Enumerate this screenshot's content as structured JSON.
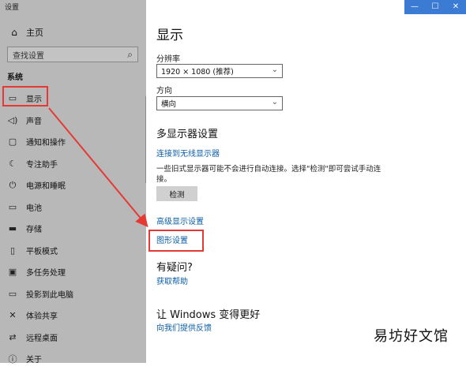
{
  "sidebar": {
    "app_title": "设置",
    "home": {
      "label": "主页",
      "icon": "home-icon"
    },
    "search_placeholder": "查找设置",
    "section_label": "系统",
    "items": [
      {
        "label": "显示",
        "icon": "monitor-icon"
      },
      {
        "label": "声音",
        "icon": "speaker-icon"
      },
      {
        "label": "通知和操作",
        "icon": "notification-icon"
      },
      {
        "label": "专注助手",
        "icon": "moon-icon"
      },
      {
        "label": "电源和睡眠",
        "icon": "power-icon"
      },
      {
        "label": "电池",
        "icon": "battery-icon"
      },
      {
        "label": "存储",
        "icon": "storage-icon"
      },
      {
        "label": "平板模式",
        "icon": "tablet-icon"
      },
      {
        "label": "多任务处理",
        "icon": "multitask-icon"
      },
      {
        "label": "投影到此电脑",
        "icon": "project-icon"
      },
      {
        "label": "体验共享",
        "icon": "share-icon"
      },
      {
        "label": "远程桌面",
        "icon": "remote-desktop-icon"
      },
      {
        "label": "关于",
        "icon": "info-icon"
      }
    ]
  },
  "window_controls": {
    "minimize": "—",
    "maximize": "☐",
    "close": "✕"
  },
  "main": {
    "title": "显示",
    "resolution": {
      "label": "分辨率",
      "value": "1920 × 1080 (推荐)"
    },
    "orientation": {
      "label": "方向",
      "value": "横向"
    },
    "multi_display": {
      "heading": "多显示器设置",
      "wireless_link": "连接到无线显示器",
      "description": "一些旧式显示器可能不会进行自动连接。选择\"检测\"即可尝试手动连接。",
      "detect_button": "检测",
      "advanced_link": "高级显示设置",
      "graphics_link": "图形设置"
    },
    "help": {
      "heading": "有疑问?",
      "link": "获取帮助"
    },
    "feedback": {
      "heading": "让 Windows 变得更好",
      "link": "向我们提供反馈"
    }
  },
  "watermark": "易坊好文馆",
  "colors": {
    "highlight": "#e53935",
    "link": "#0b5ea8",
    "sidebar_bg": "#b8b8b8"
  }
}
